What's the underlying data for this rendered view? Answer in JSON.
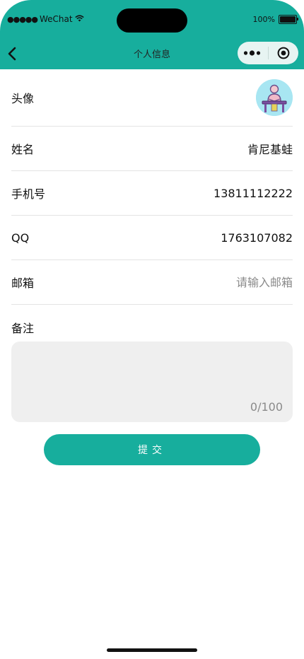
{
  "status_bar": {
    "carrier": "WeChat",
    "battery": "100%"
  },
  "nav": {
    "title": "个人信息"
  },
  "form": {
    "avatar_label": "头像",
    "name_label": "姓名",
    "name_value": "肯尼基蛙",
    "phone_label": "手机号",
    "phone_value": "13811112222",
    "qq_label": "QQ",
    "qq_value": "1763107082",
    "email_label": "邮箱",
    "email_placeholder": "请输入邮箱",
    "remark_label": "备注",
    "remark_counter": "0/100",
    "submit_label": "提交"
  },
  "colors": {
    "accent": "#17ae9d",
    "remark_bg": "#efefef"
  }
}
